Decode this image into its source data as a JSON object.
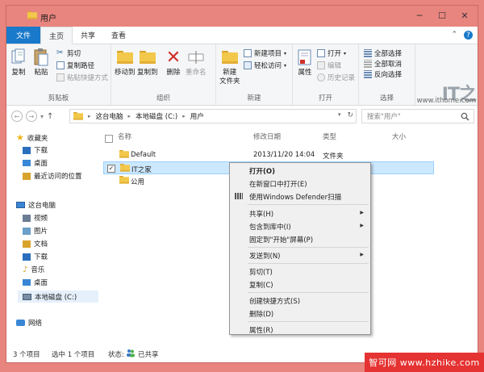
{
  "window": {
    "title": "用户"
  },
  "tabs": [
    {
      "label": "文件"
    },
    {
      "label": "主页"
    },
    {
      "label": "共享"
    },
    {
      "label": "查看"
    }
  ],
  "ribbon": {
    "clipboard": {
      "label": "剪贴板",
      "copy": "复制",
      "paste": "粘贴",
      "cut": "剪切",
      "copy_path": "复制路径",
      "paste_shortcut": "粘贴快捷方式"
    },
    "organize": {
      "label": "组织",
      "move_to": "移动到",
      "copy_to": "复制到",
      "delete": "删除",
      "rename": "重命名"
    },
    "new": {
      "label": "新建",
      "new_folder": "新建\n文件夹",
      "new_item": "新建项目",
      "easy_access": "轻松访问"
    },
    "open": {
      "label": "打开",
      "properties": "属性",
      "open": "打开",
      "edit": "编辑",
      "history": "历史记录"
    },
    "select": {
      "label": "选择",
      "select_all": "全部选择",
      "select_none": "全部取消",
      "invert": "反向选择"
    }
  },
  "address": {
    "crumbs": [
      "这台电脑",
      "本地磁盘 (C:)",
      "用户"
    ],
    "search_placeholder": "搜索\"用户\""
  },
  "nav": {
    "favorites": "收藏夹",
    "downloads": "下载",
    "desktop": "桌面",
    "recent": "最近访问的位置",
    "this_pc": "这台电脑",
    "videos": "视频",
    "pictures": "图片",
    "documents": "文档",
    "downloads2": "下载",
    "music": "音乐",
    "desktop2": "桌面",
    "local_disk": "本地磁盘 (C:)",
    "network": "网络"
  },
  "columns": {
    "name": "名称",
    "date": "修改日期",
    "type": "类型",
    "size": "大小"
  },
  "files": [
    {
      "name": "Default",
      "date": "2013/11/20 14:04",
      "type": "文件夹"
    },
    {
      "name": "IT之家",
      "date": "",
      "type": ""
    },
    {
      "name": "公用",
      "date": "",
      "type": ""
    }
  ],
  "context_menu": {
    "open": "打开(O)",
    "open_new_window": "在新窗口中打开(E)",
    "defender": "使用Windows Defender扫描",
    "share": "共享(H)",
    "include_library": "包含到库中(I)",
    "pin_start": "固定到\"开始\"屏幕(P)",
    "send_to": "发送到(N)",
    "cut": "剪切(T)",
    "copy": "复制(C)",
    "create_shortcut": "创建快捷方式(S)",
    "delete": "删除(D)",
    "properties": "属性(R)"
  },
  "status": {
    "count": "3 个项目",
    "selected": "选中 1 个项目",
    "state_label": "状态:",
    "state_value": "已共享"
  },
  "watermark": {
    "logo": "IT之",
    "url": "www.ithome.com",
    "site": "智可网 www.hzhike.com"
  },
  "colors": {
    "accent": "#1979ca",
    "frame": "#e8857e",
    "selection": "#cce8ff",
    "folder": "#f2c84b"
  }
}
